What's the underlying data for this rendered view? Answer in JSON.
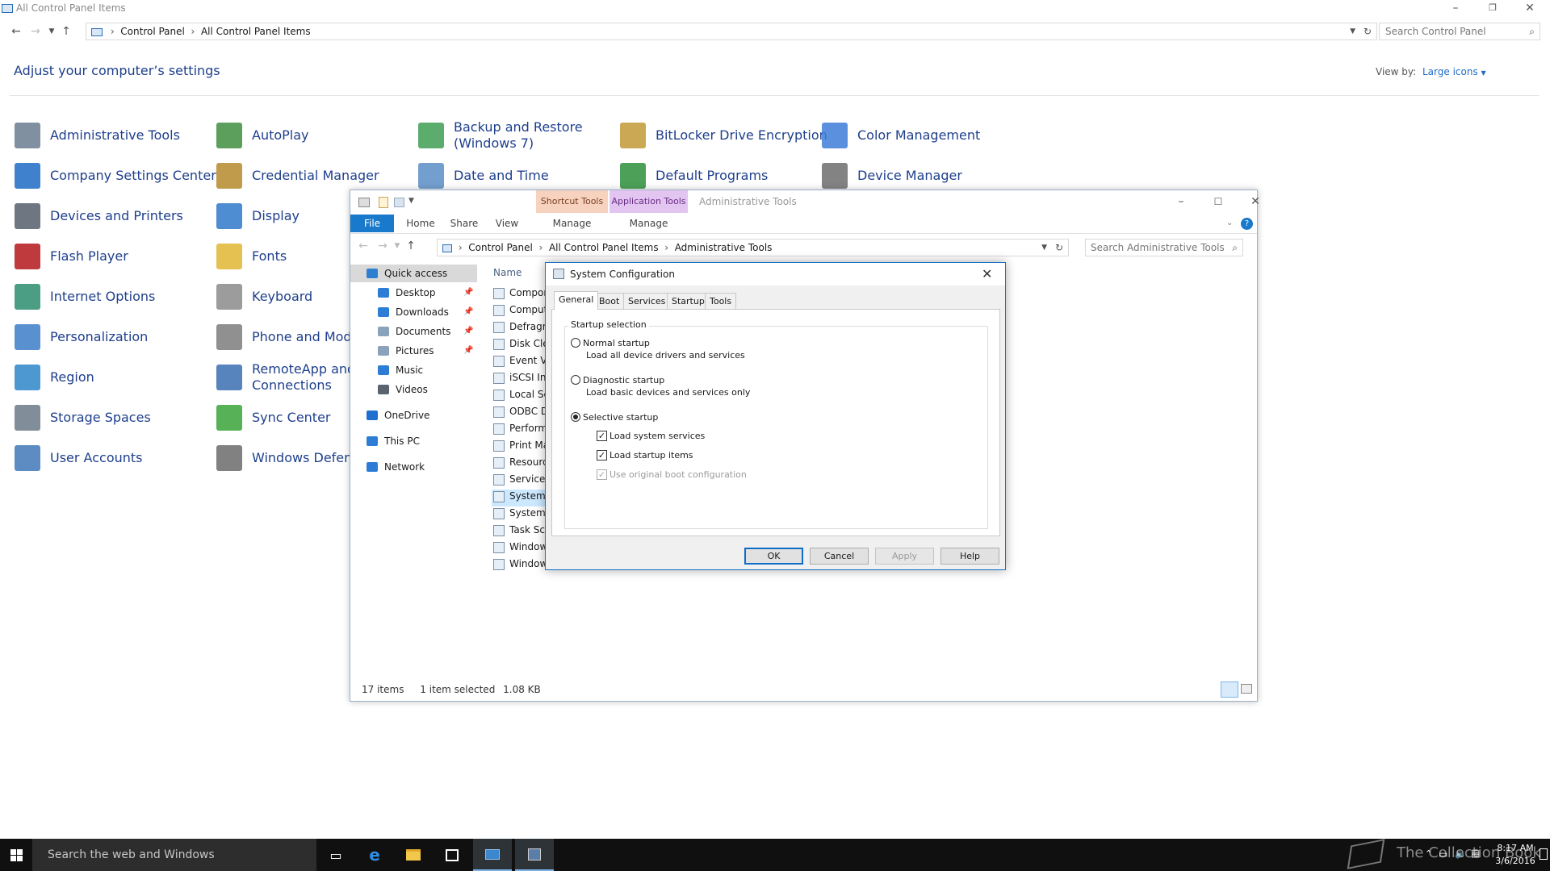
{
  "control_panel": {
    "title": "All Control Panel Items",
    "breadcrumb": [
      "Control Panel",
      "All Control Panel Items"
    ],
    "search_placeholder": "Search Control Panel",
    "heading": "Adjust your computer’s settings",
    "view_by_label": "View by:",
    "view_by_value": "Large icons",
    "items": [
      {
        "label": "Administrative Tools",
        "icon": "administrative-tools-icon",
        "color": "#6a7d8f"
      },
      {
        "label": "AutoPlay",
        "icon": "autoplay-icon",
        "color": "#3f8d3f"
      },
      {
        "label": "Backup and Restore\n(Windows 7)",
        "icon": "backup-restore-icon",
        "color": "#3f9d55"
      },
      {
        "label": "BitLocker Drive Encryption",
        "icon": "bitlocker-icon",
        "color": "#c29a36"
      },
      {
        "label": "Color Management",
        "icon": "color-management-icon",
        "color": "#3d7dd8"
      },
      {
        "label": "Company Settings Center",
        "icon": "company-settings-icon",
        "color": "#1e6bc4"
      },
      {
        "label": "Credential Manager",
        "icon": "credential-manager-icon",
        "color": "#b58a2c"
      },
      {
        "label": "Date and Time",
        "icon": "date-time-icon",
        "color": "#5b8ec7"
      },
      {
        "label": "Default Programs",
        "icon": "default-programs-icon",
        "color": "#2e8f3a"
      },
      {
        "label": "Device Manager",
        "icon": "device-manager-icon",
        "color": "#6d6d6d"
      },
      {
        "label": "Devices and Printers",
        "icon": "devices-printers-icon",
        "color": "#555e6b"
      },
      {
        "label": "Display",
        "icon": "display-icon",
        "color": "#2f79c9"
      },
      {
        "label": "Flash Player",
        "icon": "flash-player-icon",
        "color": "#b3171a"
      },
      {
        "label": "Fonts",
        "icon": "fonts-icon",
        "color": "#e0b632"
      },
      {
        "label": "Internet Options",
        "icon": "internet-options-icon",
        "color": "#2c8d6e"
      },
      {
        "label": "Keyboard",
        "icon": "keyboard-icon",
        "color": "#8b8b8b"
      },
      {
        "label": "Personalization",
        "icon": "personalization-icon",
        "color": "#3b7cc8"
      },
      {
        "label": "Phone and Modem",
        "icon": "phone-modem-icon",
        "color": "#7d7d7d"
      },
      {
        "label": "Region",
        "icon": "region-icon",
        "color": "#2f86c9"
      },
      {
        "label": "RemoteApp and Desktop\nConnections",
        "icon": "remoteapp-icon",
        "color": "#3a6fb0"
      },
      {
        "label": "Storage Spaces",
        "icon": "storage-spaces-icon",
        "color": "#6b7a88"
      },
      {
        "label": "Sync Center",
        "icon": "sync-center-icon",
        "color": "#3aa33a"
      },
      {
        "label": "User Accounts",
        "icon": "user-accounts-icon",
        "color": "#3f78b6"
      },
      {
        "label": "Windows Defender",
        "icon": "windows-defender-icon",
        "color": "#6b6b6b"
      }
    ]
  },
  "explorer": {
    "title": "Administrative Tools",
    "ribbon_groups": [
      {
        "label": "Shortcut Tools",
        "sub": "Manage",
        "color": "#f6d2bf",
        "text": "#7a3f21"
      },
      {
        "label": "Application Tools",
        "sub": "Manage",
        "color": "#e2c5f0",
        "text": "#6a2b86"
      }
    ],
    "ribbon_tabs": {
      "file": "File",
      "home": "Home",
      "share": "Share",
      "view": "View"
    },
    "breadcrumb": [
      "Control Panel",
      "All Control Panel Items",
      "Administrative Tools"
    ],
    "search_placeholder": "Search Administrative Tools",
    "column_name": "Name",
    "sidebar": [
      {
        "label": "Quick access",
        "icon": "quick-access-star-icon",
        "color": "#2f7fd1",
        "pinned": false
      },
      {
        "label": "Desktop",
        "icon": "desktop-folder-icon",
        "color": "#2d7dd6",
        "pinned": true
      },
      {
        "label": "Downloads",
        "icon": "downloads-folder-icon",
        "color": "#2d7dd6",
        "pinned": true
      },
      {
        "label": "Documents",
        "icon": "documents-folder-icon",
        "color": "#8aa2bb",
        "pinned": true
      },
      {
        "label": "Pictures",
        "icon": "pictures-folder-icon",
        "color": "#8aa2bb",
        "pinned": true
      },
      {
        "label": "Music",
        "icon": "music-folder-icon",
        "color": "#2d7dd6",
        "pinned": false
      },
      {
        "label": "Videos",
        "icon": "videos-folder-icon",
        "color": "#5a6470",
        "pinned": false
      },
      {
        "label": "OneDrive",
        "icon": "onedrive-icon",
        "color": "#1f6fd1",
        "pinned": false
      },
      {
        "label": "This PC",
        "icon": "this-pc-icon",
        "color": "#2d7dd6",
        "pinned": false
      },
      {
        "label": "Network",
        "icon": "network-icon",
        "color": "#2d7dd6",
        "pinned": false
      }
    ],
    "files": [
      "Compon",
      "Comput",
      "Defragm",
      "Disk Cle",
      "Event Vi",
      "iSCSI Ini",
      "Local Se",
      "ODBC D",
      "Perform",
      "Print Ma",
      "Resourc",
      "Services",
      "System C",
      "System I",
      "Task Sch",
      "Window",
      "Window"
    ],
    "selected_file_index": 12,
    "status_items": "17 items",
    "status_selected": "1 item selected",
    "status_size": "1.08 KB"
  },
  "dialog": {
    "title": "System Configuration",
    "tabs": [
      "General",
      "Boot",
      "Services",
      "Startup",
      "Tools"
    ],
    "group_label": "Startup selection",
    "normal": {
      "label": "Normal startup",
      "desc": "Load all device drivers and services",
      "selected": false
    },
    "diagnostic": {
      "label": "Diagnostic startup",
      "desc": "Load basic devices and services only",
      "selected": false
    },
    "selective": {
      "label": "Selective startup",
      "selected": true
    },
    "checks": {
      "system_services": "Load system services",
      "startup_items": "Load startup items",
      "original_boot": "Use original boot configuration"
    },
    "buttons": {
      "ok": "OK",
      "cancel": "Cancel",
      "apply": "Apply",
      "help": "Help"
    }
  },
  "taskbar": {
    "search_placeholder": "Search the web and Windows",
    "clock_time": "8:17 AM",
    "clock_date": "3/6/2016",
    "watermark": "The Collection Book"
  }
}
